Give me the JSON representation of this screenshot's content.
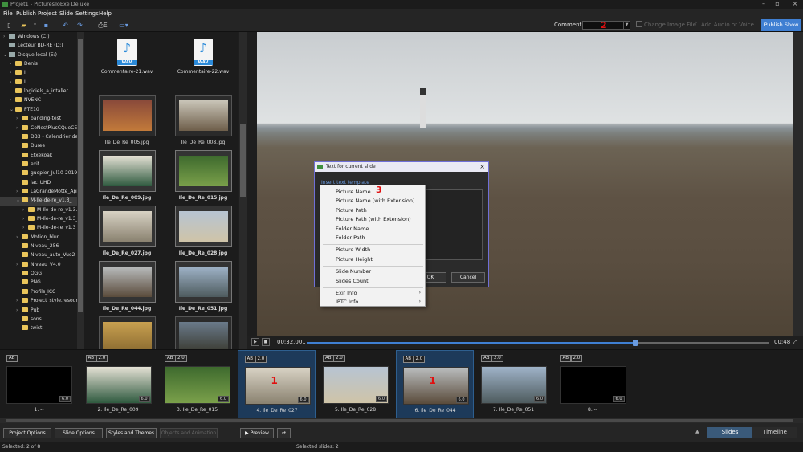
{
  "window": {
    "title": "Projet1 - PicturesToExe Deluxe"
  },
  "menu": [
    "File",
    "Publish",
    "Project",
    "Slide",
    "Settings",
    "Help"
  ],
  "toolbar": {
    "comment_label": "Comment",
    "marker_comment": "2",
    "change_image_file": "Change Image File",
    "add_audio_voice": "Add Audio or Voice",
    "publish_show": "Publish Show"
  },
  "tree": [
    {
      "label": "Windows (C:)",
      "depth": 0,
      "arrow": "›",
      "kind": "drive"
    },
    {
      "label": "Lecteur BD-RE (D:)",
      "depth": 0,
      "arrow": "",
      "kind": "drive"
    },
    {
      "label": "Disque local (E:)",
      "depth": 0,
      "arrow": "⌄",
      "kind": "drive"
    },
    {
      "label": "Denis",
      "depth": 1,
      "arrow": "›",
      "kind": "folder"
    },
    {
      "label": "I",
      "depth": 1,
      "arrow": "›",
      "kind": "folder"
    },
    {
      "label": "L",
      "depth": 1,
      "arrow": "›",
      "kind": "folder"
    },
    {
      "label": "logiciels_a_intaller",
      "depth": 1,
      "arrow": "",
      "kind": "folder"
    },
    {
      "label": "NVENC",
      "depth": 1,
      "arrow": "›",
      "kind": "folder"
    },
    {
      "label": "PTE10",
      "depth": 1,
      "arrow": "⌄",
      "kind": "folder"
    },
    {
      "label": "banding-test",
      "depth": 2,
      "arrow": "›",
      "kind": "folder"
    },
    {
      "label": "CeNestPlusCQueCEtait",
      "depth": 2,
      "arrow": "›",
      "kind": "folder"
    },
    {
      "label": "DB3 - Calendrier de l'Av",
      "depth": 2,
      "arrow": "",
      "kind": "folder"
    },
    {
      "label": "Duree",
      "depth": 2,
      "arrow": "",
      "kind": "folder"
    },
    {
      "label": "Etxekoak",
      "depth": 2,
      "arrow": "",
      "kind": "folder"
    },
    {
      "label": "exif",
      "depth": 2,
      "arrow": "",
      "kind": "folder"
    },
    {
      "label": "guepier_Jul10-2019_5-4",
      "depth": 2,
      "arrow": "",
      "kind": "folder"
    },
    {
      "label": "lac_UHD",
      "depth": 2,
      "arrow": "",
      "kind": "folder"
    },
    {
      "label": "LaGrandeMotte_Apr26-",
      "depth": 2,
      "arrow": "›",
      "kind": "folder"
    },
    {
      "label": "M-Ile-de-re_v1.3_",
      "depth": 2,
      "arrow": "⌄",
      "kind": "folder",
      "selected": true
    },
    {
      "label": "M-Ile-de-re_v1.3.resou",
      "depth": 3,
      "arrow": "›",
      "kind": "folder"
    },
    {
      "label": "M-Ile-de-re_v1.3_10.re",
      "depth": 3,
      "arrow": "›",
      "kind": "folder"
    },
    {
      "label": "M-Ile-de-re_v1.3_10au",
      "depth": 3,
      "arrow": "›",
      "kind": "folder"
    },
    {
      "label": "Motion_blur",
      "depth": 2,
      "arrow": "›",
      "kind": "folder"
    },
    {
      "label": "Niveau_256",
      "depth": 2,
      "arrow": "",
      "kind": "folder"
    },
    {
      "label": "Niveau_auto_Vue2",
      "depth": 2,
      "arrow": "",
      "kind": "folder"
    },
    {
      "label": "Niveau_V4.0_",
      "depth": 2,
      "arrow": "›",
      "kind": "folder"
    },
    {
      "label": "OGG",
      "depth": 2,
      "arrow": "",
      "kind": "folder"
    },
    {
      "label": "PNG",
      "depth": 2,
      "arrow": "",
      "kind": "folder"
    },
    {
      "label": "Profils_ICC",
      "depth": 2,
      "arrow": "",
      "kind": "folder"
    },
    {
      "label": "Project_style.resources",
      "depth": 2,
      "arrow": "›",
      "kind": "folder"
    },
    {
      "label": "Pub",
      "depth": 2,
      "arrow": "›",
      "kind": "folder"
    },
    {
      "label": "sons",
      "depth": 2,
      "arrow": "",
      "kind": "folder"
    },
    {
      "label": "twist",
      "depth": 2,
      "arrow": "",
      "kind": "folder"
    }
  ],
  "files": [
    {
      "name": "Commentaire-21.wav",
      "type": "wav",
      "icon_label": "WAV"
    },
    {
      "name": "Commentaire-22.wav",
      "type": "wav",
      "icon_label": "WAV"
    },
    {
      "name": "Ile_De_Re_005.jpg",
      "type": "img",
      "selected": false,
      "colors": [
        "#8a4a3a",
        "#c27a3a"
      ]
    },
    {
      "name": "Ile_De_Re_008.jpg",
      "type": "img",
      "selected": false,
      "colors": [
        "#c9c5b8",
        "#6e5e4a"
      ]
    },
    {
      "name": "Ile_De_Re_009.jpg",
      "type": "img",
      "selected": true,
      "colors": [
        "#e4e0d4",
        "#2f5a3f"
      ]
    },
    {
      "name": "Ile_De_Re_015.jpg",
      "type": "img",
      "selected": true,
      "colors": [
        "#3e6a2e",
        "#7aa04a"
      ]
    },
    {
      "name": "Ile_De_Re_027.jpg",
      "type": "img",
      "selected": true,
      "colors": [
        "#d8d2c4",
        "#8a8270"
      ]
    },
    {
      "name": "Ile_De_Re_028.jpg",
      "type": "img",
      "selected": true,
      "colors": [
        "#b7c4d2",
        "#cfc4a8"
      ]
    },
    {
      "name": "Ile_De_Re_044.jpg",
      "type": "img",
      "selected": true,
      "colors": [
        "#b9bcbd",
        "#5a4b3b"
      ]
    },
    {
      "name": "Ile_De_Re_051.jpg",
      "type": "img",
      "selected": true,
      "colors": [
        "#9fb3c8",
        "#4e5b5e"
      ]
    },
    {
      "name": "",
      "type": "img",
      "selected": false,
      "colors": [
        "#c8a050",
        "#8a6a30"
      ]
    },
    {
      "name": "",
      "type": "img",
      "selected": false,
      "colors": [
        "#6a7a8a",
        "#3a3a30"
      ]
    }
  ],
  "playbar": {
    "time_current": "00:32.001",
    "time_total": "00:48",
    "progress": 0.71
  },
  "dialog": {
    "title": "Text for current slide",
    "insert_link": "Insert text template",
    "ok": "OK",
    "cancel": "Cancel",
    "marker": "3"
  },
  "context_menu": [
    {
      "label": "Picture Name"
    },
    {
      "label": "Picture Name (with Extension)"
    },
    {
      "label": "Picture Path"
    },
    {
      "label": "Picture Path (with Extension)"
    },
    {
      "label": "Folder Name"
    },
    {
      "label": "Folder Path"
    },
    {
      "label": "Picture Width",
      "sep_before": true
    },
    {
      "label": "Picture Height"
    },
    {
      "label": "Slide Number",
      "sep_before": true
    },
    {
      "label": "Slides Count"
    },
    {
      "label": "Exif Info",
      "sep_before": true,
      "submenu": true
    },
    {
      "label": "IPTC Info",
      "submenu": true
    }
  ],
  "slides": [
    {
      "caption": "1. --",
      "badges": [
        "AB"
      ],
      "duration": "6.0",
      "colors": [
        "#000000",
        "#000000"
      ]
    },
    {
      "caption": "2. Ile_De_Re_009",
      "badges": [
        "AB",
        "2.0"
      ],
      "duration": "6.0",
      "colors": [
        "#e4e0d4",
        "#2f5a3f"
      ]
    },
    {
      "caption": "3. Ile_De_Re_015",
      "badges": [
        "AB",
        "2.0"
      ],
      "duration": "6.0",
      "colors": [
        "#3e6a2e",
        "#7aa04a"
      ]
    },
    {
      "caption": "4. Ile_De_Re_027",
      "badges": [
        "AB",
        "2.0"
      ],
      "duration": "6.0",
      "colors": [
        "#d8d2c4",
        "#8a8270"
      ],
      "selected": true,
      "marker": "1"
    },
    {
      "caption": "5. Ile_De_Re_028",
      "badges": [
        "AB",
        "2.0"
      ],
      "duration": "6.0",
      "colors": [
        "#b7c4d2",
        "#cfc4a8"
      ]
    },
    {
      "caption": "6. Ile_De_Re_044",
      "badges": [
        "AB",
        "2.0"
      ],
      "duration": "6.0",
      "colors": [
        "#b9bcbd",
        "#5a4b3b"
      ],
      "selected": true,
      "marker": "1"
    },
    {
      "caption": "7. Ile_De_Re_051",
      "badges": [
        "AB",
        "2.0"
      ],
      "duration": "6.0",
      "colors": [
        "#9fb3c8",
        "#4e5b5e"
      ]
    },
    {
      "caption": "8. --",
      "badges": [
        "AB",
        "2.0"
      ],
      "duration": "6.0",
      "colors": [
        "#000000",
        "#000000"
      ]
    }
  ],
  "bottom": {
    "project_options": "Project Options",
    "slide_options": "Slide Options",
    "styles_themes": "Styles and Themes",
    "objects_animation": "Objects and Animation",
    "preview": "Preview",
    "tab_slides": "Slides",
    "tab_timeline": "Timeline"
  },
  "status": {
    "left": "Selected: 2 of 8",
    "right": "Selected slides: 2"
  },
  "colors": {
    "accent": "#3f7fd2",
    "marker": "#e01010"
  }
}
